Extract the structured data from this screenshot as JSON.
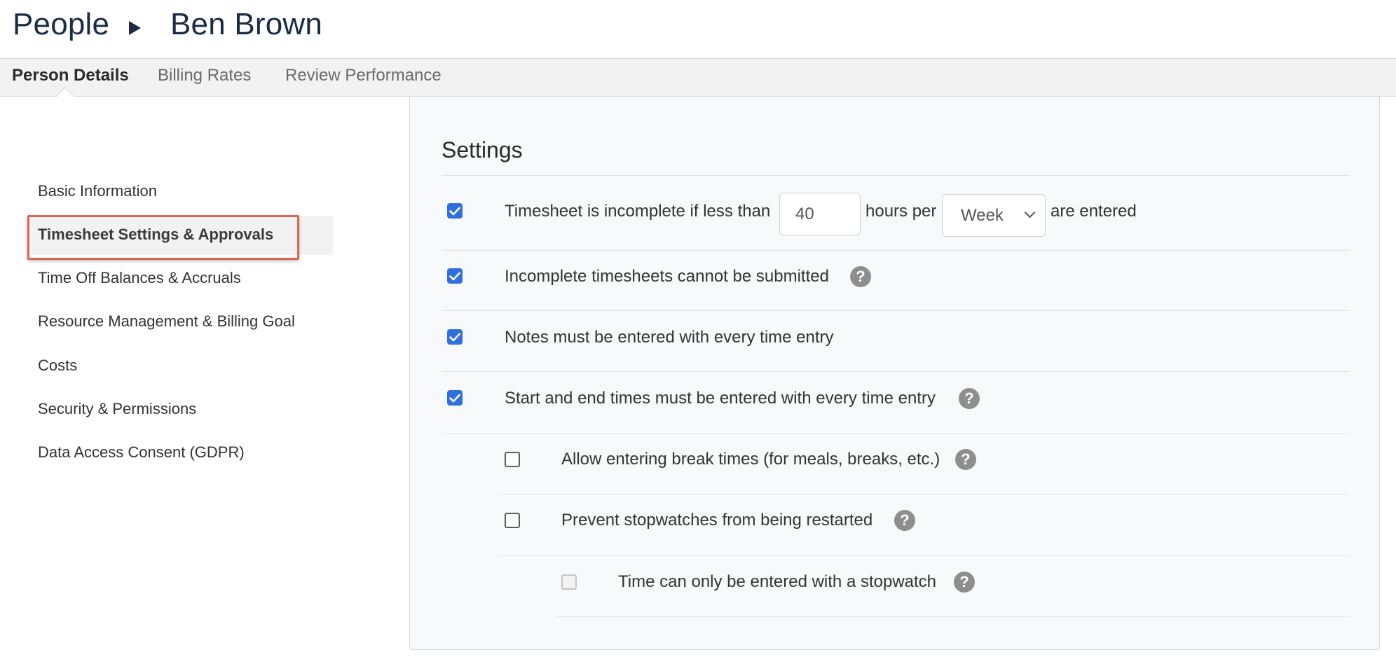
{
  "breadcrumb": {
    "root": "People",
    "current": "Ben Brown"
  },
  "tabs": [
    {
      "label": "Person Details",
      "active": true
    },
    {
      "label": "Billing Rates",
      "active": false
    },
    {
      "label": "Review Performance",
      "active": false
    }
  ],
  "sidebar": {
    "items": [
      {
        "label": "Basic Information"
      },
      {
        "label": "Timesheet Settings & Approvals",
        "active": true
      },
      {
        "label": "Time Off Balances & Accruals"
      },
      {
        "label": "Resource Management & Billing Goal"
      },
      {
        "label": "Costs"
      },
      {
        "label": "Security & Permissions"
      },
      {
        "label": "Data Access Consent (GDPR)"
      }
    ],
    "highlight_color": "#d96754"
  },
  "settings": {
    "title": "Settings",
    "rows": [
      {
        "checked": true,
        "label_prefix": "Timesheet is incomplete if less than",
        "hours_value": "40",
        "label_middle": "hours per",
        "period_selected": "Week",
        "label_suffix": "are entered"
      },
      {
        "checked": true,
        "label": "Incomplete timesheets cannot be submitted",
        "help_icon": "question-circle-icon"
      },
      {
        "checked": true,
        "label": "Notes must be entered with every time entry"
      },
      {
        "checked": true,
        "label": "Start and end times must be entered with every time entry",
        "help_icon": "question-circle-icon"
      },
      {
        "checked": false,
        "label": "Allow entering break times (for meals, breaks, etc.)",
        "help_icon": "question-circle-icon"
      },
      {
        "checked": false,
        "label": "Prevent stopwatches from being restarted",
        "help_icon": "question-circle-icon"
      },
      {
        "checked": false,
        "disabled": true,
        "label": "Time can only be entered with a stopwatch",
        "help_icon": "question-circle-icon"
      }
    ],
    "help_glyph": "?"
  },
  "colors": {
    "accent": "#2f6fde",
    "heading": "#1b2b45"
  }
}
